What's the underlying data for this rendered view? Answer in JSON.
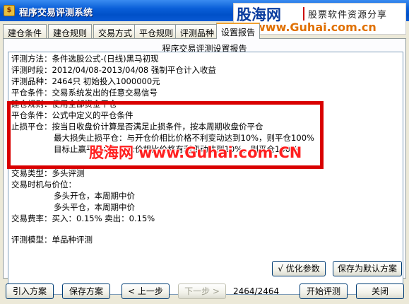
{
  "window": {
    "title": "程序交易评测系统",
    "icon": "app-icon"
  },
  "watermark_logo": {
    "name": "股海网",
    "slogan": "股票软件资源分享",
    "url": "www.Guhai.com.cn"
  },
  "tabs": [
    {
      "label": "建仓条件"
    },
    {
      "label": "建仓规则"
    },
    {
      "label": "交易方式"
    },
    {
      "label": "平仓规则"
    },
    {
      "label": "评测品种"
    },
    {
      "label": "设置报告"
    }
  ],
  "report": {
    "title": "程序交易评测设置报告",
    "lines": [
      "评测方法：条件选股公式-(日线)黑马初现",
      "评测时段：2012/04/08-2013/04/08 强制平仓计入收益",
      "评测品种：2464只  初始投入1000000元",
      "平仓条件：交易系统发出的任意交易信号",
      "建仓规则：使用全部资金平仓",
      "平仓条件：公式中定义的平仓条件",
      "止损平仓：按当日收盘价计算是否满足止损条件，按本周期收盘价平仓",
      "最大损失止损平仓：与开仓价相比价格不利变动达到10%，则平仓100%",
      "目标止赢平仓：与开仓价相比价格有利变动达到10%，则平仓100%",
      "交易类型：多头评测",
      "交易时机与价位：",
      "多头开仓，本周期中价",
      "多头平仓，本周期中价",
      "交易费率：买入：0.15%    卖出：0.15%",
      "评测模型：单品种评测"
    ]
  },
  "overlay_watermark": "股海网 www.Guhai.com.CN",
  "buttons": {
    "optimize": "√ 优化参数",
    "save_default": "保存为默认方案",
    "import": "引入方案",
    "save": "保存方案",
    "prev": "< 上一步",
    "next": "下一步 >",
    "start": "开始评测",
    "close": "关闭"
  },
  "page_indicator": "2464/2464",
  "colors": {
    "titlebar": "#0a5fd8",
    "highlight_box": "#d90000",
    "watermark": "#ff2020"
  }
}
